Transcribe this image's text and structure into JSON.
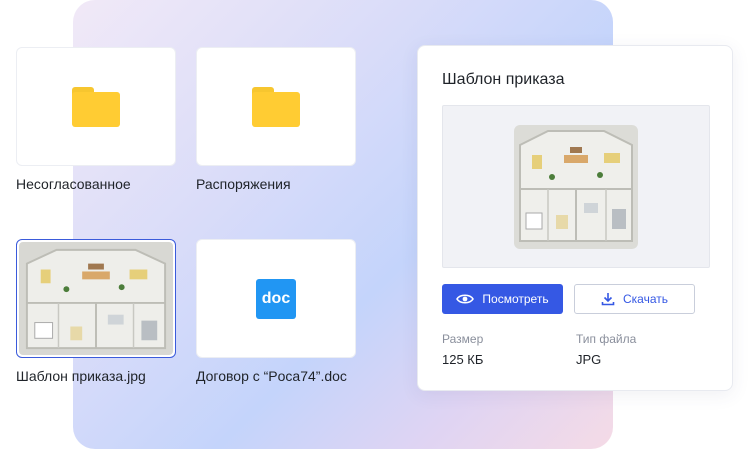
{
  "tiles": [
    {
      "label": "Несогласованное",
      "icon": "folder-icon"
    },
    {
      "label": "Распоряжения",
      "icon": "folder-icon"
    },
    {
      "label": "Шаблон приказа.jpg",
      "icon": "image-thumbnail",
      "selected": true
    },
    {
      "label": "Договор с “Poca74”.doc",
      "icon": "doc-icon",
      "badge": "doc"
    }
  ],
  "panel": {
    "title": "Шаблон приказа",
    "view_button": "Посмотреть",
    "download_button": "Скачать",
    "size_label": "Размер",
    "size_value": "125 КБ",
    "type_label": "Тип файла",
    "type_value": "JPG"
  },
  "colors": {
    "accent": "#3558e4",
    "folder": "#ffcc33",
    "doc_badge": "#2196f3"
  }
}
